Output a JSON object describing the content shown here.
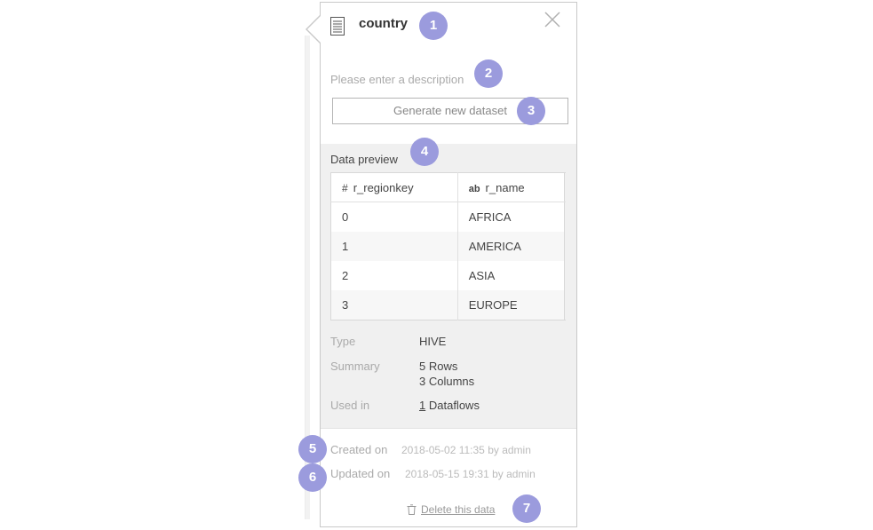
{
  "dataset": {
    "name": "country"
  },
  "description": {
    "placeholder": "Please enter a description"
  },
  "actions": {
    "generate_label": "Generate new dataset",
    "delete_label": "Delete this data"
  },
  "preview": {
    "label": "Data preview",
    "columns": [
      {
        "type_glyph": "#",
        "type": "number",
        "name": "r_regionkey"
      },
      {
        "type_glyph": "ab",
        "type": "string",
        "name": "r_name"
      }
    ],
    "rows": [
      [
        "0",
        "AFRICA"
      ],
      [
        "1",
        "AMERICA"
      ],
      [
        "2",
        "ASIA"
      ],
      [
        "3",
        "EUROPE"
      ]
    ]
  },
  "details": {
    "type_label": "Type",
    "type_value": "HIVE",
    "summary_label": "Summary",
    "summary_rows": "5 Rows",
    "summary_columns": "3 Columns",
    "used_label": "Used in",
    "used_count": "1",
    "used_suffix": "Dataflows"
  },
  "footer": {
    "created_label": "Created on",
    "created_value": "2018-05-02 11:35 by admin",
    "updated_label": "Updated on",
    "updated_value": "2018-05-15 19:31 by admin"
  },
  "annotations": [
    "1",
    "2",
    "3",
    "4",
    "5",
    "6",
    "7"
  ],
  "icons": {
    "title": "dataset-table-icon",
    "close": "close-icon",
    "delete": "trash-icon"
  },
  "colors": {
    "badge": "#9b9bdd",
    "panel_border": "#c9c9c9",
    "section_bg": "#f0f0f0",
    "muted_text": "#aaaaaa",
    "body_text": "#444444"
  }
}
